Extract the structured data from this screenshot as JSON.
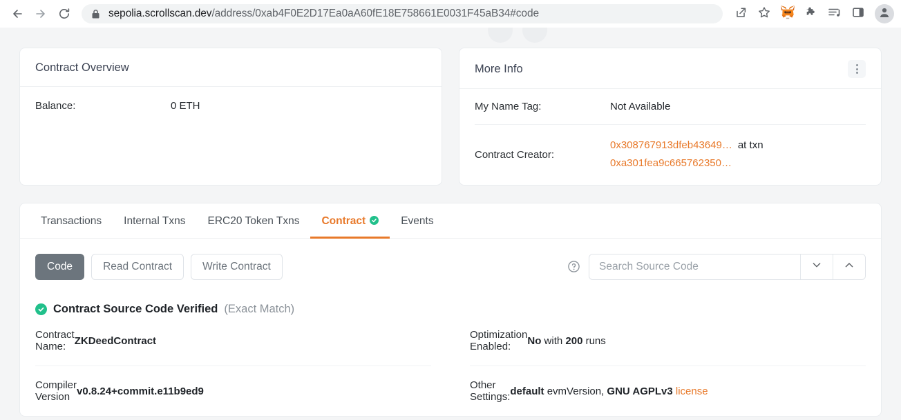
{
  "browser": {
    "back_icon": "back-arrow-icon",
    "forward_icon": "forward-arrow-icon",
    "reload_icon": "reload-icon",
    "lock_icon": "lock-icon",
    "url_host": "sepolia.scrollscan.dev",
    "url_path": "/address/0xab4F0E2D17Ea0aA60fE18E758661E0031F45aB34#code",
    "url_full": "sepolia.scrollscan.dev/address/0xab4F0E2D17Ea0aA60fE18E758661E0031F45aB34#code",
    "share_icon": "share-icon",
    "bookmark_icon": "star-icon",
    "metamask_icon": "metamask-fox-icon",
    "extensions_icon": "puzzle-piece-icon",
    "media_icon": "media-list-icon",
    "sidebar_icon": "sidebar-panel-icon",
    "profile_icon": "profile-avatar-icon"
  },
  "contract_overview": {
    "title": "Contract Overview",
    "balance_label": "Balance:",
    "balance_value": "0 ETH"
  },
  "more_info": {
    "title": "More Info",
    "kebab_icon": "more-options-icon",
    "name_tag_label": "My Name Tag:",
    "name_tag_value": "Not Available",
    "creator_label": "Contract Creator:",
    "creator_address": "0x308767913dfeb43649…",
    "at_txn_label": "at txn",
    "creator_txn": "0xa301fea9c665762350…"
  },
  "tabs": [
    {
      "label": "Transactions",
      "active": false
    },
    {
      "label": "Internal Txns",
      "active": false
    },
    {
      "label": "ERC20 Token Txns",
      "active": false
    },
    {
      "label": "Contract",
      "active": true
    },
    {
      "label": "Events",
      "active": false
    }
  ],
  "code_toolbar": {
    "code_label": "Code",
    "read_label": "Read Contract",
    "write_label": "Write Contract",
    "help_icon": "help-circle-icon",
    "search_placeholder": "Search Source Code",
    "search_value": "",
    "next_icon": "chevron-down-icon",
    "prev_icon": "chevron-up-icon"
  },
  "verification": {
    "badge_icon": "verified-check-icon",
    "title": "Contract Source Code Verified",
    "match": "(Exact Match)"
  },
  "details": {
    "left": [
      {
        "label": "Contract Name:",
        "value": "ZKDeedContract"
      },
      {
        "label": "Compiler Version",
        "value": "v0.8.24+commit.e11b9ed9"
      }
    ],
    "right": [
      {
        "label": "Optimization Enabled:",
        "value": "No with 200 runs"
      },
      {
        "label": "Other Settings:",
        "value": "default evmVersion, GNU AGPLv3 license"
      }
    ]
  },
  "details_rich": {
    "optimization": {
      "bold1": "No",
      "mid": " with ",
      "bold2": "200",
      "tail": " runs"
    },
    "other_settings": {
      "bold1": "default",
      "mid": " evmVersion, ",
      "bold2": "GNU AGPLv3",
      "link": "license"
    }
  },
  "colors": {
    "accent_orange": "#e8792a",
    "verified_green": "#21c08b",
    "page_bg": "#f4f5f6",
    "button_gray": "#6c757d"
  }
}
